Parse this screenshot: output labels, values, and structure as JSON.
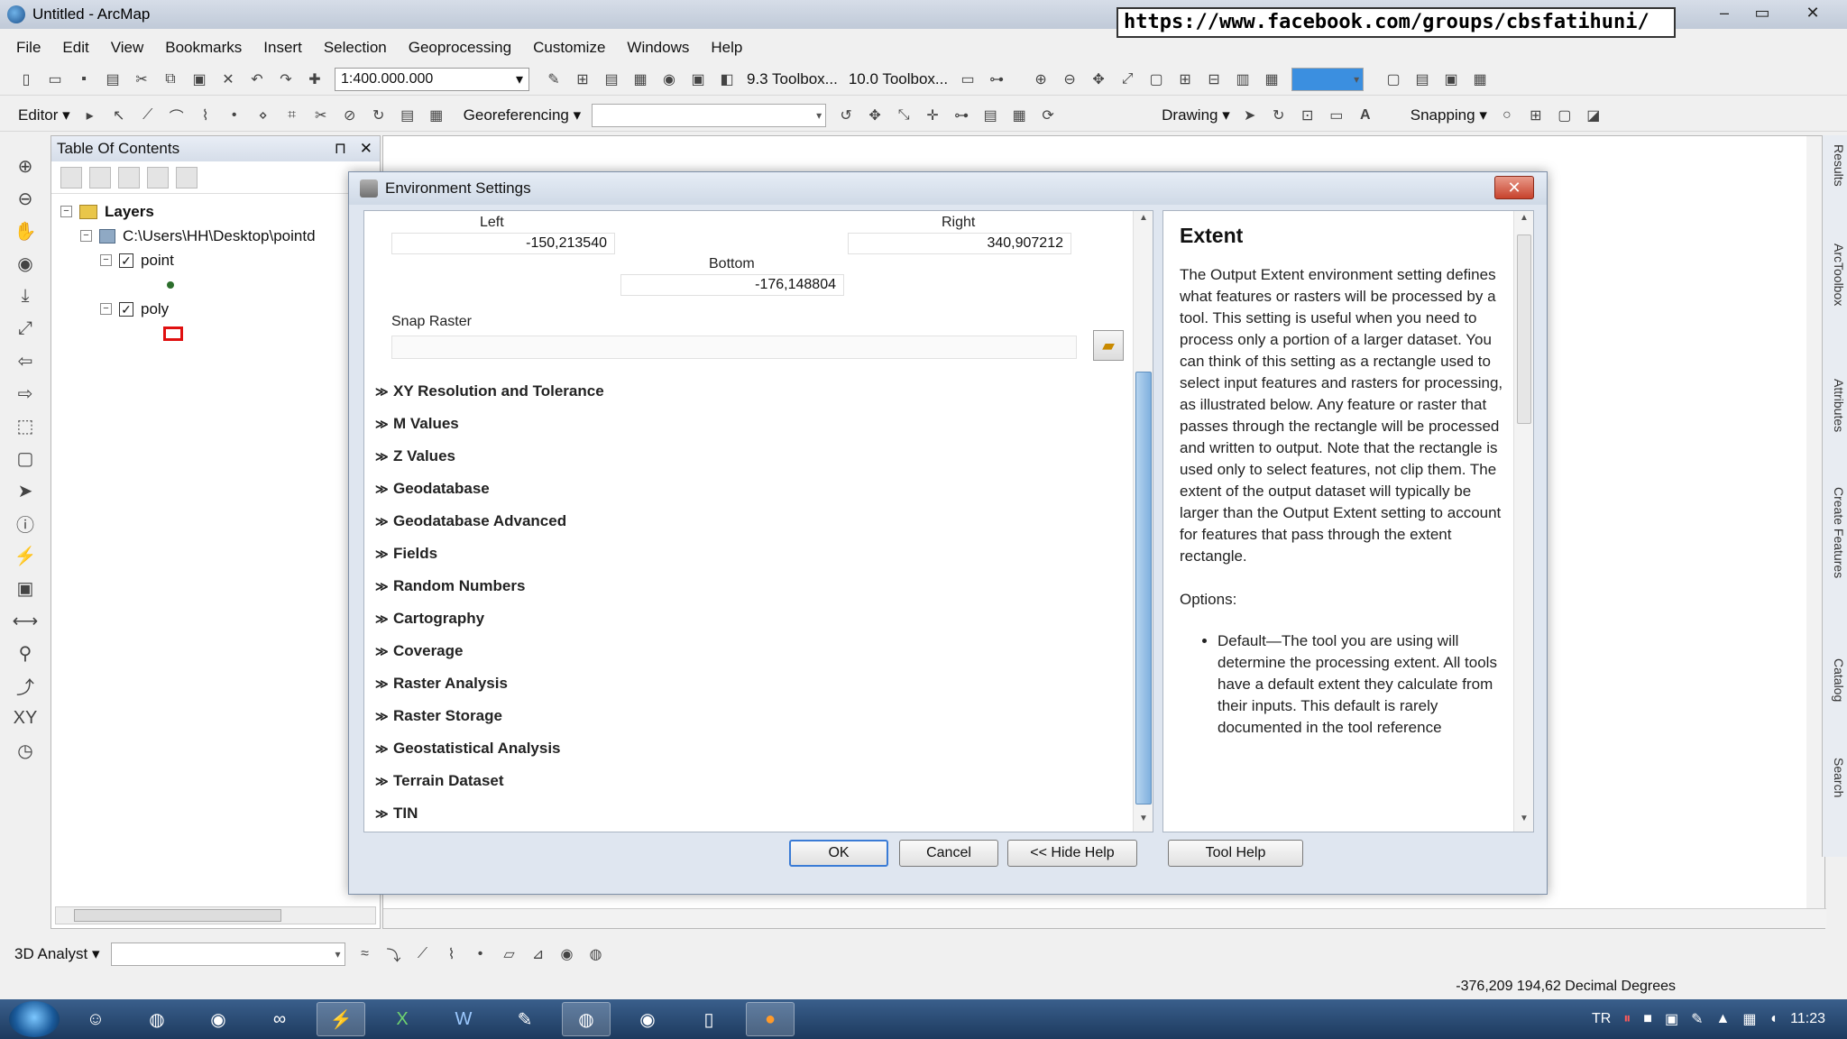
{
  "window": {
    "title": "Untitled - ArcMap",
    "overlay_url": "https://www.facebook.com/groups/cbsfatihuni/",
    "minimize": "–",
    "maximize": "▭",
    "close": "✕"
  },
  "menu": [
    "File",
    "Edit",
    "View",
    "Bookmarks",
    "Insert",
    "Selection",
    "Geoprocessing",
    "Customize",
    "Windows",
    "Help"
  ],
  "toolbar": {
    "scale": "1:400.000.000",
    "toolbox_93": "9.3 Toolbox...",
    "toolbox_100": "10.0 Toolbox...",
    "editor": "Editor ▾",
    "georeferencing": "Georeferencing ▾",
    "drawing": "Drawing ▾",
    "snapping": "Snapping ▾"
  },
  "toc": {
    "title": "Table Of Contents",
    "pin": "⊓",
    "close": "✕",
    "layers_label": "Layers",
    "path": "C:\\Users\\HH\\Desktop\\pointd",
    "layers": [
      {
        "name": "point",
        "checked": "✓",
        "expander": "−"
      },
      {
        "name": "poly",
        "checked": "✓",
        "expander": "−"
      }
    ]
  },
  "dialog": {
    "title": "Environment Settings",
    "close": "✕",
    "extent": {
      "left_label": "Left",
      "left_value": "-150,213540",
      "right_label": "Right",
      "right_value": "340,907212",
      "bottom_label": "Bottom",
      "bottom_value": "-176,148804"
    },
    "snap_raster_label": "Snap Raster",
    "sections": [
      "XY Resolution and Tolerance",
      "M Values",
      "Z Values",
      "Geodatabase",
      "Geodatabase Advanced",
      "Fields",
      "Random Numbers",
      "Cartography",
      "Coverage",
      "Raster Analysis",
      "Raster Storage",
      "Geostatistical Analysis",
      "Terrain Dataset",
      "TIN"
    ],
    "buttons": {
      "ok": "OK",
      "cancel": "Cancel",
      "hide_help": "<< Hide Help",
      "tool_help": "Tool Help"
    },
    "help": {
      "title": "Extent",
      "body": "The Output Extent environment setting defines what features or rasters will be processed by a tool. This setting is useful when you need to process only a portion of a larger dataset. You can think of this setting as a rectangle used to select input features and rasters for processing, as illustrated below. Any feature or raster that passes through the rectangle will be processed and written to output. Note that the rectangle is used only to select features, not clip them. The extent of the output dataset will typically be larger than the Output Extent setting to account for features that pass through the extent rectangle.",
      "options_label": "Options:",
      "bullet": "Default—The tool you are using will determine the processing extent. All tools have a default extent they calculate from their inputs. This default is rarely documented in the tool reference"
    }
  },
  "right_rail": [
    "Results",
    "ArcToolbox",
    "Attributes",
    "Create Features",
    "Catalog",
    "Search"
  ],
  "bottom_toolbar": {
    "analyst": "3D Analyst ▾"
  },
  "status_text": "-376,209  194,62 Decimal Degrees",
  "taskbar": {
    "lang": "TR",
    "clock": "11:23"
  }
}
